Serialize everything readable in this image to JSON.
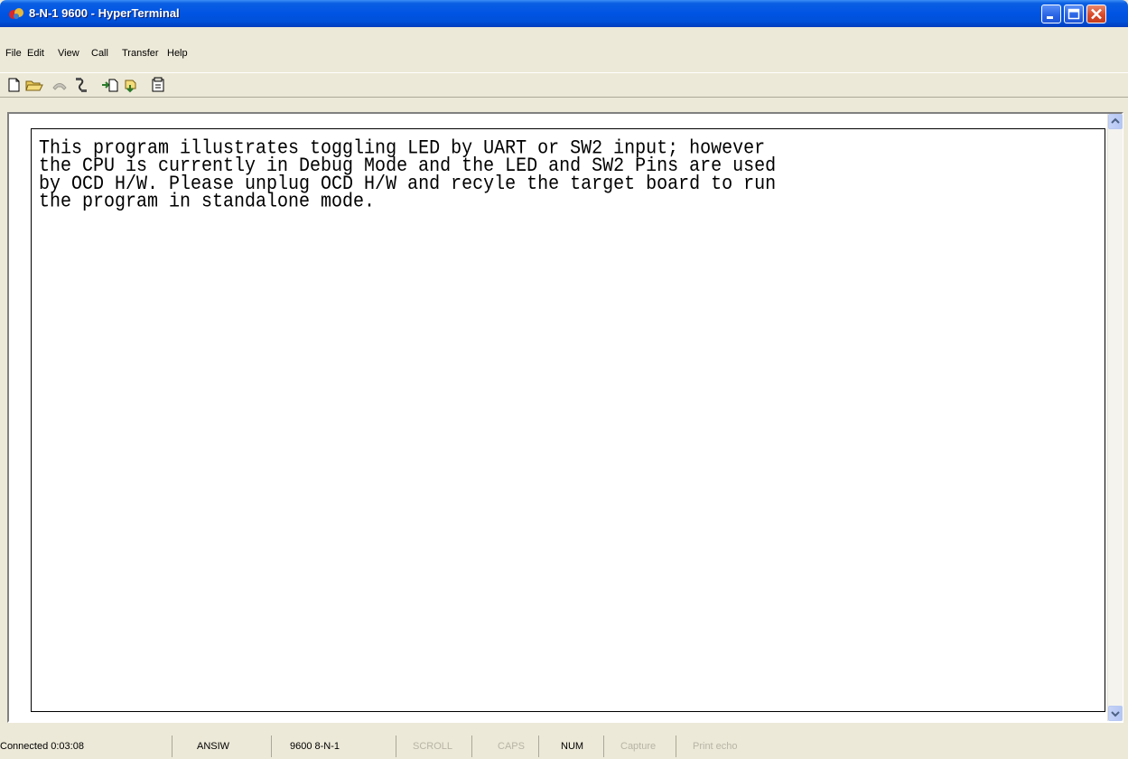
{
  "window": {
    "title": "8-N-1 9600 - HyperTerminal"
  },
  "menu": {
    "file": "File",
    "edit": "Edit",
    "view": "View",
    "call": "Call",
    "transfer": "Transfer",
    "help": "Help"
  },
  "toolbar": {
    "icons": [
      "new-document-icon",
      "open-folder-icon",
      "disconnected-phone-icon",
      "phone-hangup-icon",
      "send-file-icon",
      "receive-file-icon",
      "properties-icon"
    ]
  },
  "terminal": {
    "lines": [
      "This program illustrates toggling LED by UART or SW2 input; however",
      "the CPU is currently in Debug Mode and the LED and SW2 Pins are used",
      "by OCD H/W. Please unplug OCD H/W and recyle the target board to run",
      "the program in standalone mode."
    ]
  },
  "status": {
    "connected": "Connected 0:03:08",
    "emulation": "ANSIW",
    "settings": "9600 8-N-1",
    "scroll": "SCROLL",
    "caps": "CAPS",
    "num": "NUM",
    "capture": "Capture",
    "print_echo": "Print echo"
  },
  "colors": {
    "titlebar": "#0054e3",
    "chrome": "#ece9d8",
    "close_button": "#d9492a"
  }
}
